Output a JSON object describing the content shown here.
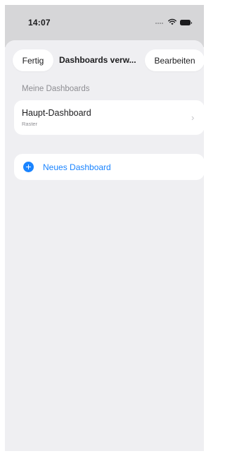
{
  "status_bar": {
    "time": "14:07",
    "icons": [
      "cellular-signal-icon",
      "wifi-icon",
      "battery-icon"
    ]
  },
  "nav": {
    "done_label": "Fertig",
    "title": "Dashboards verw...",
    "edit_label": "Bearbeiten"
  },
  "section": {
    "header": "Meine Dashboards"
  },
  "dashboards": [
    {
      "name": "Haupt-Dashboard",
      "layout": "Raster"
    }
  ],
  "new_dashboard": {
    "label": "Neues Dashboard",
    "icon": "plus-circle-icon"
  },
  "colors": {
    "accent": "#1a84ff",
    "sheet_background": "#efeff2",
    "card_background": "#ffffff",
    "secondary_text": "#8e8e93"
  }
}
